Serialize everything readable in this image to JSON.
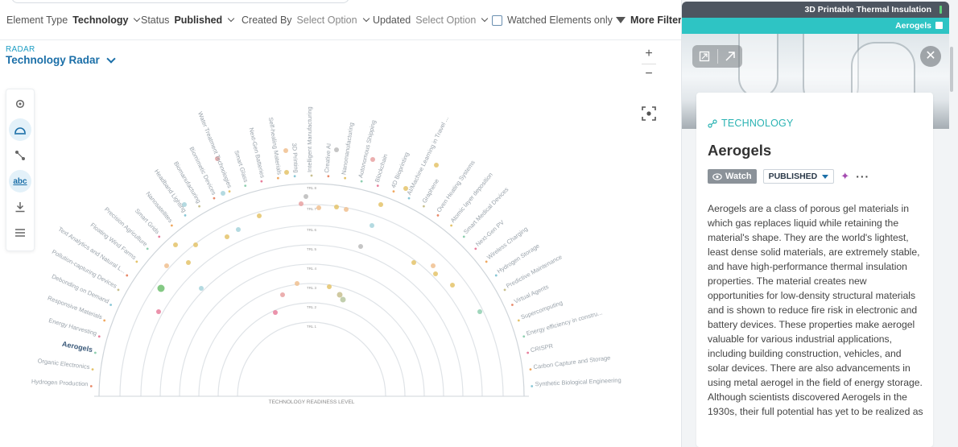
{
  "filters": {
    "element_type_label": "Element Type",
    "element_type_value": "Technology",
    "status_label": "Status",
    "status_value": "Published",
    "created_by_label": "Created By",
    "created_by_value": "Select Option",
    "updated_label": "Updated",
    "updated_value": "Select Option",
    "watched_label": "Watched Elements only",
    "more_filters_label": "More Filters"
  },
  "radar": {
    "section_label": "RADAR",
    "title": "Technology Radar",
    "axis_label": "TECHNOLOGY READINESS LEVEL",
    "ring_labels": [
      "TRL 1",
      "TRL 2",
      "TRL 3",
      "TRL 4",
      "TRL 5",
      "TRL 6",
      "TRL 7",
      "TRL 8",
      "TRL 9"
    ],
    "items": [
      "Hydrogen Production",
      "Organic Electronics",
      "Aerogels",
      "Energy Harvesting",
      "Responsive Materials",
      "Debonding on Demand",
      "Pollution-capturing Devices",
      "Text Analytics and Natural L...",
      "Floating Wind Farms",
      "Precision Agriculture",
      "Smart Grids",
      "Nanosatellites",
      "Headband Lighting",
      "Biomanufacturing",
      "Biomimetic Devices",
      "Water Treatment Technologies",
      "Smart Glass",
      "Next-Gen Batteries",
      "Self-healing Materials",
      "3D Printing",
      "Intelligent Manufacturing",
      "Creative AI",
      "Nanomanufacturing",
      "Autonomous Shipping",
      "Blockchain",
      "4D Bioprinting",
      "AI/Machine Learning in Travel ...",
      "Graphene",
      "Oven Heating Systems",
      "Atomic layer deposition",
      "Smart Medical Devices",
      "Next-Gen PV",
      "Wireless Charging",
      "Hydrogen Storage",
      "Predictive Maintenance",
      "Virtual Agents",
      "Supercomputing",
      "Energy efficiency in constru...",
      "CRISPR",
      "Carbon Capture and Storage",
      "Synthetic Biological Engineering"
    ],
    "highlighted_item": "Aerogels",
    "colors": {
      "accent": "#1b6fa8",
      "teal": "#2ec4c4",
      "ring": "#dfe3e7"
    }
  },
  "panel": {
    "top_label": "3D Printable Thermal Insulation",
    "tab_label": "Aerogels",
    "type_label": "TECHNOLOGY",
    "title": "Aerogels",
    "watch_label": "Watch",
    "status_label": "PUBLISHED",
    "more_label": "···",
    "description": "Aerogels are a class of porous gel materials in which gas replaces liquid while retaining the material's shape. They are the world's lightest, least dense solid materials, are extremely stable, and have high-performance thermal insulation properties. The material creates new opportunities for low-density structural materials and is shown to reduce fire risk in electronic and battery devices. These properties make aerogel valuable for various industrial applications, including building construction, vehicles, and solar devices. There are also advancements in using metal aerogel in the field of energy storage. Although scientists discovered Aerogels in the 1930s, their full potential has yet to be realized as"
  }
}
